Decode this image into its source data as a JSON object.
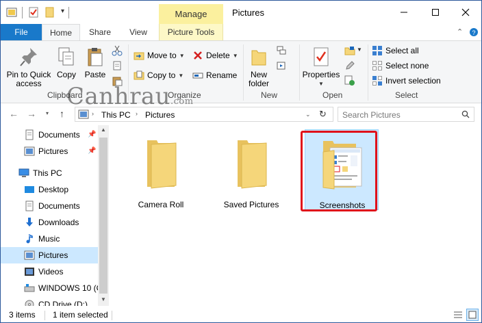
{
  "window": {
    "title": "Pictures",
    "contextual_tab": "Manage"
  },
  "tabs": {
    "file": "File",
    "home": "Home",
    "share": "Share",
    "view": "View",
    "picture_tools": "Picture Tools"
  },
  "ribbon": {
    "clipboard": {
      "pin": "Pin to Quick access",
      "copy": "Copy",
      "paste": "Paste",
      "label": "Clipboard"
    },
    "organize": {
      "move_to": "Move to",
      "copy_to": "Copy to",
      "delete": "Delete",
      "rename": "Rename",
      "label": "Organize"
    },
    "new": {
      "new_folder": "New folder",
      "label": "New"
    },
    "open": {
      "properties": "Properties",
      "label": "Open"
    },
    "select": {
      "select_all": "Select all",
      "select_none": "Select none",
      "invert": "Invert selection",
      "label": "Select"
    }
  },
  "address": {
    "crumbs": [
      "This PC",
      "Pictures"
    ],
    "search_placeholder": "Search Pictures"
  },
  "nav": {
    "items": [
      {
        "label": "Documents",
        "icon": "documents-icon",
        "pinned": true
      },
      {
        "label": "Pictures",
        "icon": "pictures-icon",
        "pinned": true
      },
      {
        "label": "This PC",
        "icon": "computer-icon"
      },
      {
        "label": "Desktop",
        "icon": "desktop-icon"
      },
      {
        "label": "Documents",
        "icon": "documents-icon"
      },
      {
        "label": "Downloads",
        "icon": "download-icon"
      },
      {
        "label": "Music",
        "icon": "music-icon"
      },
      {
        "label": "Pictures",
        "icon": "pictures-icon",
        "selected": true
      },
      {
        "label": "Videos",
        "icon": "videos-icon"
      },
      {
        "label": "WINDOWS 10 (C",
        "icon": "drive-icon"
      },
      {
        "label": "CD Drive (D:)",
        "icon": "cd-drive-icon"
      }
    ]
  },
  "files": [
    {
      "name": "Camera Roll"
    },
    {
      "name": "Saved Pictures"
    },
    {
      "name": "Screenshots",
      "selected": true
    }
  ],
  "status": {
    "count": "3 items",
    "selection": "1 item selected"
  },
  "watermark": {
    "main": "Canhrau",
    "suffix": ".com"
  },
  "colors": {
    "accent": "#1979ca",
    "manage_tab": "#fbf09e",
    "selection": "#cce8ff",
    "highlight_box": "#e0101a",
    "folder": "#f5d67a"
  }
}
